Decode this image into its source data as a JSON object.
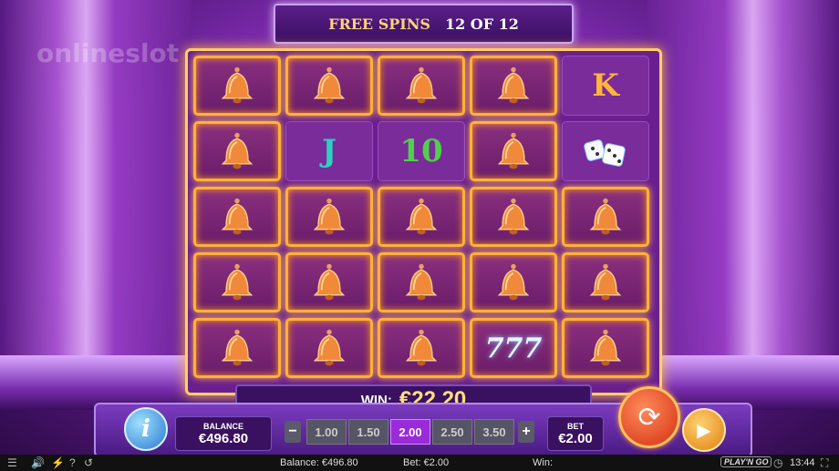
{
  "watermark": "onlineslot",
  "banner": {
    "label": "FREE SPINS",
    "count": "12 OF 12"
  },
  "grid": [
    [
      "bell",
      "bell",
      "bell",
      "bell",
      "K"
    ],
    [
      "bell",
      "J",
      "10",
      "bell",
      "dice"
    ],
    [
      "bell",
      "bell",
      "bell",
      "bell",
      "bell"
    ],
    [
      "bell",
      "bell",
      "bell",
      "bell",
      "bell"
    ],
    [
      "bell",
      "bell",
      "bell",
      "777",
      "bell"
    ]
  ],
  "win": {
    "label": "WIN:",
    "amount": "€22.20"
  },
  "balance": {
    "label": "BALANCE",
    "value": "€496.80"
  },
  "bet": {
    "label": "BET",
    "value": "€2.00",
    "options": [
      "1.00",
      "1.50",
      "2.00",
      "2.50",
      "3.50"
    ],
    "selected": "2.00"
  },
  "status_bar": {
    "balance": "Balance: €496.80",
    "bet": "Bet: €2.00",
    "win": "Win:",
    "brand": "PLAY'N GO",
    "time": "13:44"
  },
  "colors": {
    "gold": "#ffcf6a",
    "win_text": "#ffe07a",
    "selected_bet": "#9b2bd8"
  }
}
